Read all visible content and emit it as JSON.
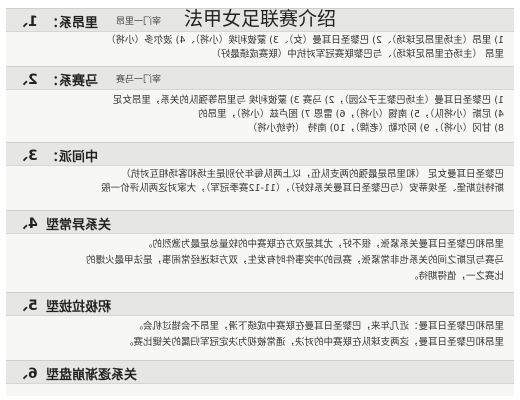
{
  "title": "法甲女足联赛介绍",
  "sections": [
    {
      "num": "1、",
      "name": "里昂系：",
      "sub": "宰门一里昂",
      "lines": [
        "1) 里昂（主场里昂足球场）、2) 巴黎圣日耳曼（女）、3) 蒙彼利埃（小将）、4) 波尔多（小将）",
        "里昂 （主场在里昂足球场）、与巴黎联赛冠军对抗中（联赛成绩最好）"
      ]
    },
    {
      "num": "2、",
      "name": "马赛系：",
      "sub": "宰门一马赛",
      "lines": [
        "1) 巴黎圣日耳曼（主场巴黎王子公园），2) 马赛 3) 蒙彼利埃 与里昂等强队的关系，里昂女足",
        "4) 尼斯（小将队），5) 南锡（小将），6) 雷恩 7) 图卢兹（小将），里昂的",
        "8) 甘冈（小将），9) 阿尔勒（老牌），10) 南特 （传统小将）"
      ]
    },
    {
      "num": "3、",
      "name": "中间派：",
      "sub": "",
      "lines": [
        "巴黎圣日耳曼女足 （和里昂是最强的两支队伍，以上两队每年分别是主场和客场相互对抗）",
        "斯特拉斯堡、圣埃蒂安（与巴黎圣日耳曼关系较好），（11-12赛季冠军），大家对这两队评价一般"
      ]
    },
    {
      "num": "4、",
      "name": "关系异常型",
      "sub": "",
      "lines": [
        "里昂和巴黎圣日耳曼关系紧张，很不好，尤其是双方在联赛中的较量总是最为激烈的。",
        "马赛与尼斯之间的关系也非常紧张，赛后的冲突事件时有发生，双方球迷经常闹事，是法甲最火爆的",
        "比赛之一，值得期待。"
      ]
    },
    {
      "num": "5、",
      "name": "积极拉拢型",
      "sub": "",
      "lines": [
        "里昂和巴黎圣日耳曼：近几年来，巴黎圣日耳曼在联赛中成绩下滑，里昂不会错过机会。",
        "里昂和巴黎圣日耳曼，这两支球队在联赛中的对决，通常被视为决定冠军归属的关键比赛。"
      ]
    },
    {
      "num": "6、",
      "name": "关系逐渐崩盘型",
      "sub": "",
      "lines": []
    }
  ],
  "colors": {
    "header_bg": "#e6e6e3",
    "highlight_red": "#b01818",
    "highlight_blue": "#1a3a9a"
  }
}
